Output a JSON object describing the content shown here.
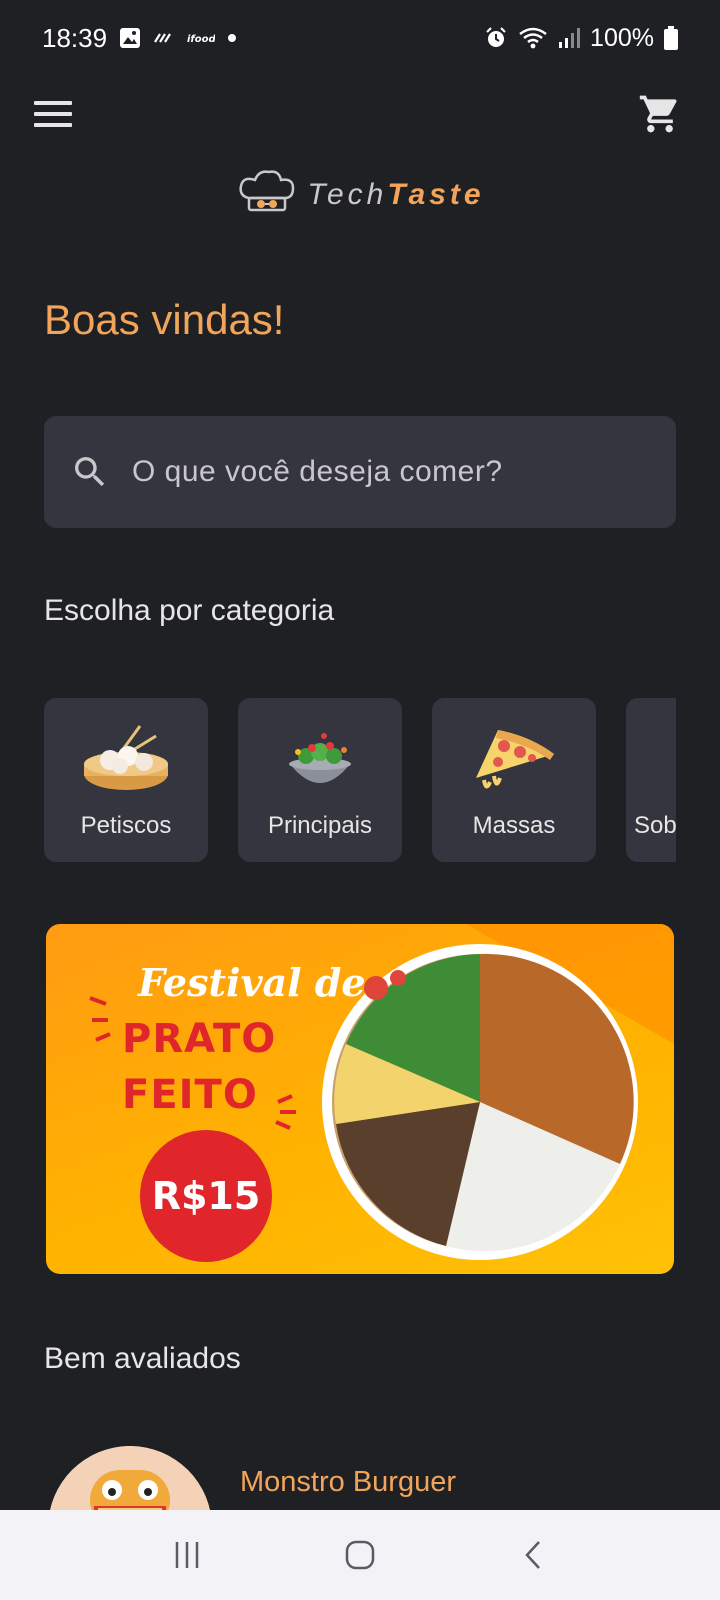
{
  "status_bar": {
    "time": "18:39",
    "battery": "100%",
    "icons_left": [
      "image-icon",
      "signal-bars-icon",
      "ifood-icon",
      "dot-icon"
    ],
    "icons_right": [
      "alarm-icon",
      "wifi-icon",
      "cell-signal-icon",
      "battery-icon"
    ]
  },
  "app_bar": {
    "menu_icon": "menu-icon",
    "cart_icon": "cart-icon"
  },
  "logo": {
    "text_regular": "Tech",
    "text_bold": "Taste",
    "icon": "chef-hat-icon"
  },
  "home": {
    "welcome": "Boas vindas!",
    "search": {
      "placeholder": "O que você deseja comer?"
    },
    "categories_title": "Escolha por categoria",
    "categories": [
      {
        "label": "Petiscos",
        "icon": "dumplings-icon"
      },
      {
        "label": "Principais",
        "icon": "salad-bowl-icon"
      },
      {
        "label": "Massas",
        "icon": "pizza-icon"
      },
      {
        "label": "Sob"
      }
    ],
    "banner": {
      "line1": "Festival de",
      "line2": "PRATO",
      "line3": "FEITO",
      "price": "R$15"
    },
    "rated_title": "Bem avaliados",
    "rated_items": [
      {
        "name": "Monstro Burguer"
      }
    ]
  },
  "colors": {
    "background": "#1f2023",
    "surface": "#34353e",
    "accent": "#f2a55a",
    "banner_orange": "#ff9b12",
    "banner_red": "#e0252b"
  }
}
